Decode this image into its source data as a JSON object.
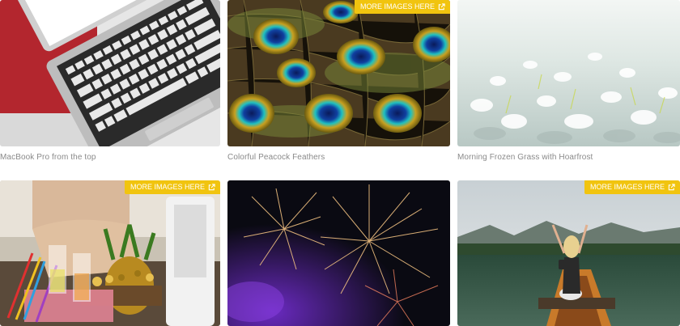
{
  "gallery": {
    "more_label": "MORE IMAGES HERE",
    "accent_color": "#f1c40f",
    "items": [
      {
        "caption": "MacBook Pro from the top",
        "has_more_button": false
      },
      {
        "caption": "Colorful Peacock Feathers",
        "has_more_button": true
      },
      {
        "caption": "Morning Frozen Grass with Hoarfrost",
        "has_more_button": false
      },
      {
        "caption": "",
        "has_more_button": true
      },
      {
        "caption": "",
        "has_more_button": false
      },
      {
        "caption": "",
        "has_more_button": true
      }
    ]
  }
}
